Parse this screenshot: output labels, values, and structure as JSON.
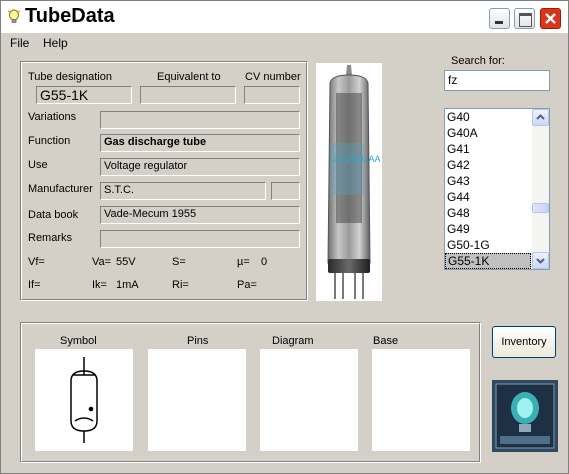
{
  "window": {
    "title": "TubeData"
  },
  "menu": {
    "file": "File",
    "help": "Help"
  },
  "details": {
    "headers": {
      "designation": "Tube designation",
      "equivalent": "Equivalent to",
      "cv": "CV number"
    },
    "designation": "G55-1K",
    "equivalent": "",
    "cv": "",
    "labels": {
      "variations": "Variations",
      "function": "Function",
      "use": "Use",
      "manufacturer": "Manufacturer",
      "databook": "Data book",
      "remarks": "Remarks"
    },
    "variations": "",
    "function": "Gas discharge tube",
    "use": "Voltage regulator",
    "manufacturer": "S.T.C.",
    "manufacturer_code": "",
    "databook": "Vade-Mecum 1955",
    "remarks": "",
    "params": {
      "vf_label": "Vf=",
      "vf": "",
      "va_label": "Va=",
      "va": "55V",
      "s_label": "S=",
      "s": "",
      "mu_label": "µ=",
      "mu": "0",
      "if_label": "If=",
      "if": "",
      "ik_label": "Ik=",
      "ik": "1mA",
      "ri_label": "Ri=",
      "ri": "",
      "pa_label": "Pa=",
      "pa": ""
    }
  },
  "search": {
    "label": "Search for:",
    "value": "fz"
  },
  "tube_list": {
    "items": [
      "G40",
      "G40A",
      "G41",
      "G42",
      "G43",
      "G44",
      "G48",
      "G49",
      "G50-1G",
      "G55-1K"
    ],
    "selected": "G55-1K"
  },
  "panels": {
    "symbol": "Symbol",
    "pins": "Pins",
    "diagram": "Diagram",
    "base": "Base"
  },
  "buttons": {
    "inventory": "Inventory"
  },
  "photo": {
    "printing": "ZZ 1000 AA 7212"
  }
}
